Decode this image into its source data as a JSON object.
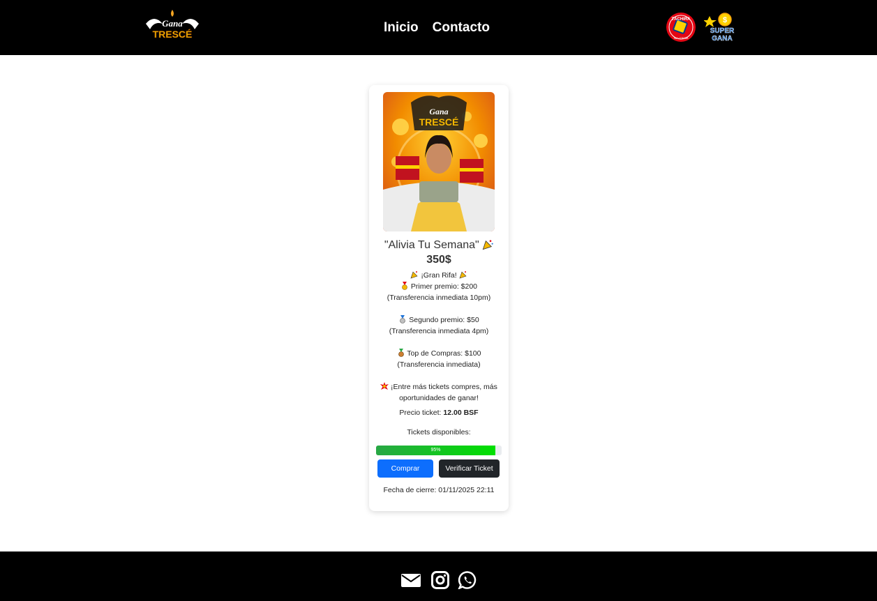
{
  "header": {
    "logo_alt": "Gana Trescé",
    "logo_text_top": "Gana",
    "logo_text_bottom": "TRESCÉ",
    "nav": [
      {
        "label": "Inicio"
      },
      {
        "label": "Contacto"
      }
    ],
    "partners": [
      {
        "name": "Táchira Lotería",
        "text_top": "TÁCHIRA",
        "text_bottom": "SU LOTERÍA"
      },
      {
        "name": "Super Gana",
        "text_top": "SUPER",
        "text_bottom": "GANA"
      }
    ]
  },
  "raffle": {
    "image_alt": "Gana Trescé promo",
    "title": "\"Alivia Tu Semana\"",
    "price": "350$",
    "lines": [
      "¡Gran Rifa!",
      "Primer premio: $200",
      "(Transferencia inmediata 10pm)",
      "",
      "Segundo premio: $50",
      "(Transferencia inmediata 4pm)",
      "",
      "Top de Compras: $100",
      "(Transferencia inmediata)",
      "",
      "¡Entre más tickets compres, más oportunidades de ganar!"
    ],
    "ticket_price_label": "Precio ticket:",
    "ticket_price_value": "12.00 BSF",
    "available_label": "Tickets disponibles:",
    "progress_percent": 95,
    "progress_label": "95%",
    "buy_label": "Comprar",
    "verify_label": "Verificar Ticket",
    "closing_label": "Fecha de cierre: 01/11/2025 22:11"
  },
  "footer": {
    "icons": [
      "envelope-icon",
      "instagram-icon",
      "whatsapp-icon"
    ]
  },
  "colors": {
    "header_bg": "#000000",
    "primary_button": "#0d6efd",
    "dark_button": "#212529",
    "progress_green": "#28a745"
  }
}
